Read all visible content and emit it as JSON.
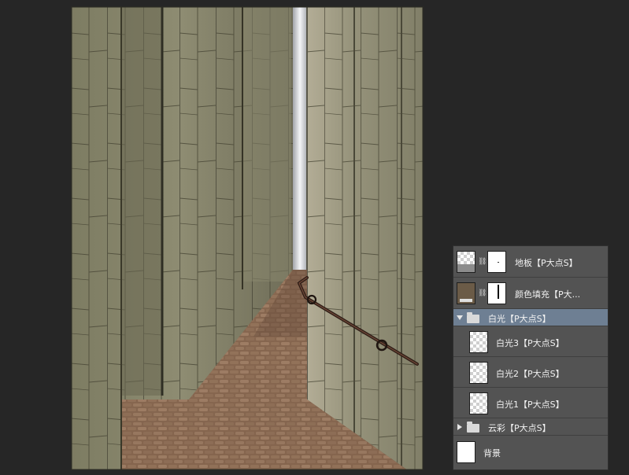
{
  "canvas": {
    "image_name": "stone-alley-canvas"
  },
  "layers": [
    {
      "name": "地板【P大点S】",
      "kind": "layer-with-mask",
      "selected": false
    },
    {
      "name": "颜色填充【P大...",
      "kind": "fill-with-mask",
      "selected": false
    },
    {
      "name": "白光【P大点S】",
      "kind": "group-open",
      "selected": true
    },
    {
      "name": "白光3【P大点S】",
      "kind": "layer",
      "selected": false
    },
    {
      "name": "白光2【P大点S】",
      "kind": "layer",
      "selected": false
    },
    {
      "name": "白光1【P大点S】",
      "kind": "layer",
      "selected": false
    },
    {
      "name": "云彩【P大点S】",
      "kind": "group-closed",
      "selected": false
    },
    {
      "name": "背景",
      "kind": "background",
      "selected": false
    }
  ],
  "colors": {
    "fill_swatch": "#6b5b47",
    "selected_row": "#6e7f93",
    "panel": "#535353",
    "app_background": "#262626"
  }
}
